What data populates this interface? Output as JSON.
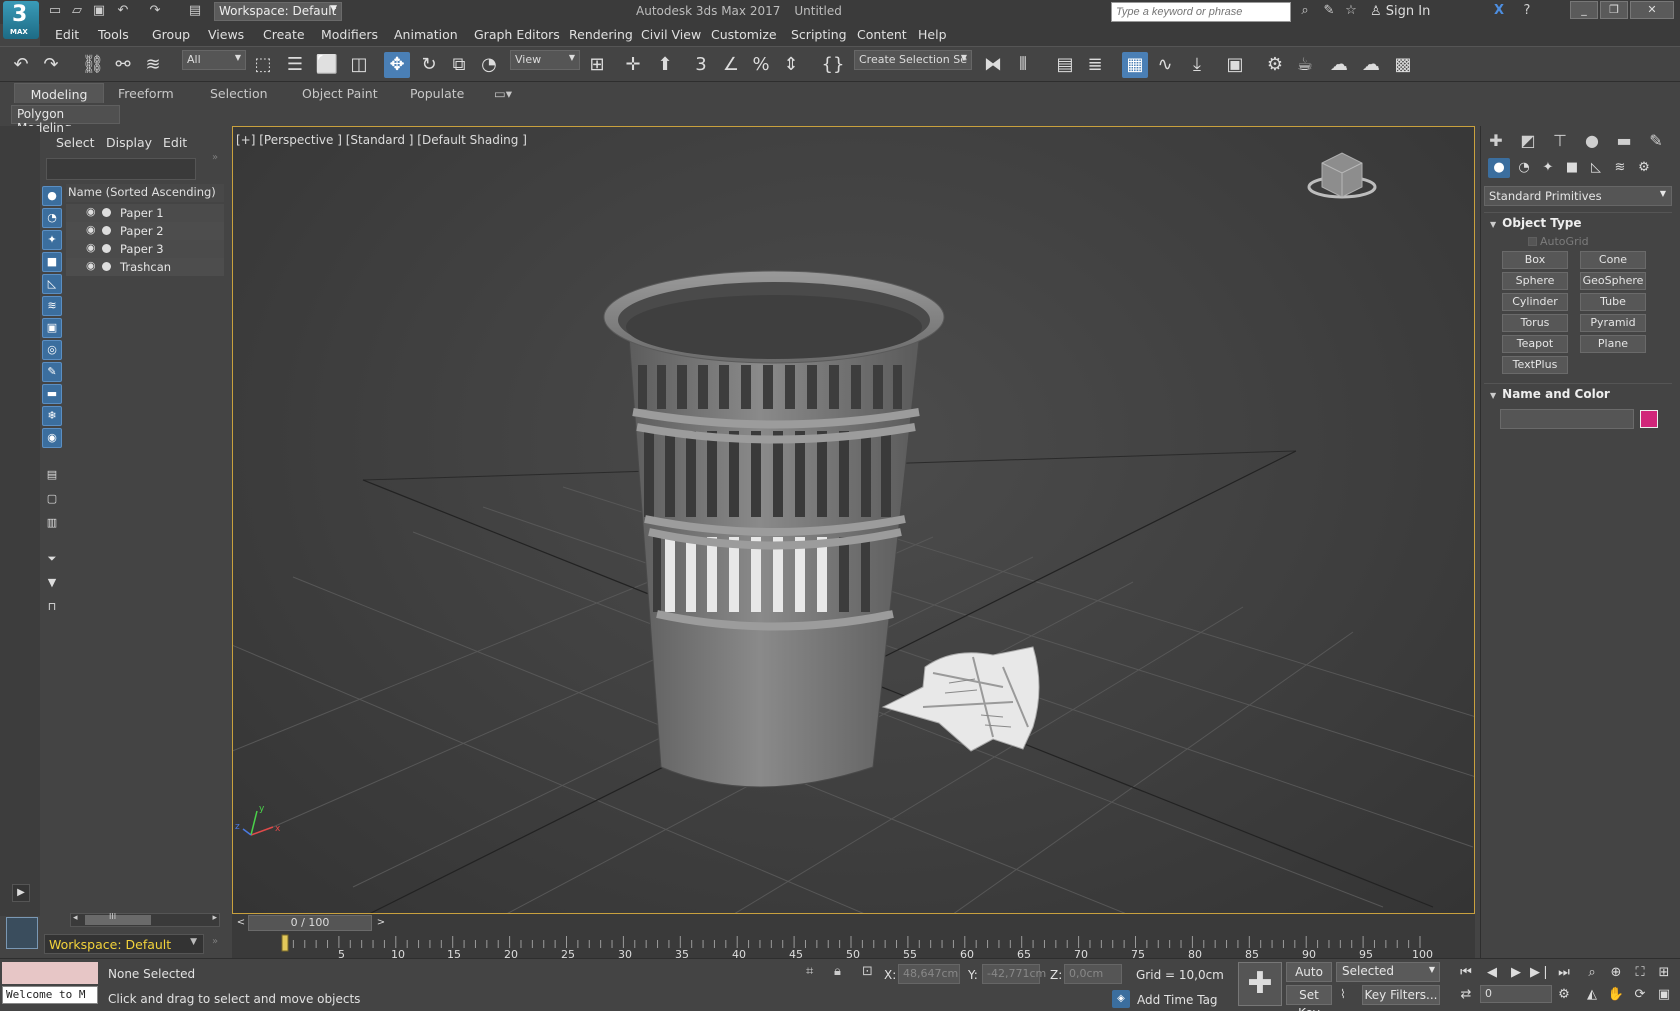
{
  "app": {
    "logo_number": "3",
    "logo_sub": "MAX",
    "workspace": "Workspace: Default",
    "title": "Autodesk 3ds Max 2017",
    "document": "Untitled",
    "search_placeholder": "Type a keyword or phrase",
    "sign_in": "Sign In"
  },
  "menu": [
    "Edit",
    "Tools",
    "Group",
    "Views",
    "Create",
    "Modifiers",
    "Animation",
    "Graph Editors",
    "Rendering",
    "Civil View",
    "Customize",
    "Scripting",
    "Content",
    "Help"
  ],
  "toolbar": {
    "selection_filter": "All",
    "reference_coord": "View",
    "named_selection": "Create Selection Se"
  },
  "ribbon": {
    "tabs": [
      "Modeling",
      "Freeform",
      "Selection",
      "Object Paint",
      "Populate"
    ],
    "active_tab": "Modeling",
    "panel": "Polygon Modeling"
  },
  "explorer": {
    "tabs": [
      "Select",
      "Display",
      "Edit"
    ],
    "header": "Name (Sorted Ascending)",
    "items": [
      "Paper 1",
      "Paper 2",
      "Paper 3",
      "Trashcan"
    ],
    "scroll_glyph": "III",
    "workspace": "Workspace: Default"
  },
  "viewport": {
    "label": "[+] [Perspective ] [Standard ] [Default Shading ]",
    "axis_x": "x",
    "axis_y": "y",
    "axis_z": "z"
  },
  "timeline": {
    "frame": "0 / 100",
    "ticks": [
      "5",
      "10",
      "15",
      "20",
      "25",
      "30",
      "35",
      "40",
      "45",
      "50",
      "55",
      "60",
      "65",
      "70",
      "75",
      "80",
      "85",
      "90",
      "95",
      "100"
    ]
  },
  "status": {
    "listener": "Welcome to M",
    "selection": "None Selected",
    "prompt": "Click and drag to select and move objects",
    "x_label": "X:",
    "x_value": "48,647cm",
    "y_label": "Y:",
    "y_value": "-42,771cm",
    "z_label": "Z:",
    "z_value": "0,0cm",
    "grid": "Grid = 10,0cm",
    "add_time_tag": "Add Time Tag",
    "auto_key": "Auto Key",
    "set_key": "Set Key",
    "key_mode": "Selected",
    "key_filters": "Key Filters...",
    "current_frame": "0"
  },
  "command_panel": {
    "category": "Standard Primitives",
    "object_type_title": "Object Type",
    "autogrid": "AutoGrid",
    "buttons": [
      "Box",
      "Cone",
      "Sphere",
      "GeoSphere",
      "Cylinder",
      "Tube",
      "Torus",
      "Pyramid",
      "Teapot",
      "Plane",
      "TextPlus"
    ],
    "name_color_title": "Name and Color",
    "object_color": "#d1267a"
  },
  "colors": {
    "viewport_border": "#c9a13e",
    "workspace_text": "#f3d33b",
    "accent": "#4a7fb5"
  }
}
